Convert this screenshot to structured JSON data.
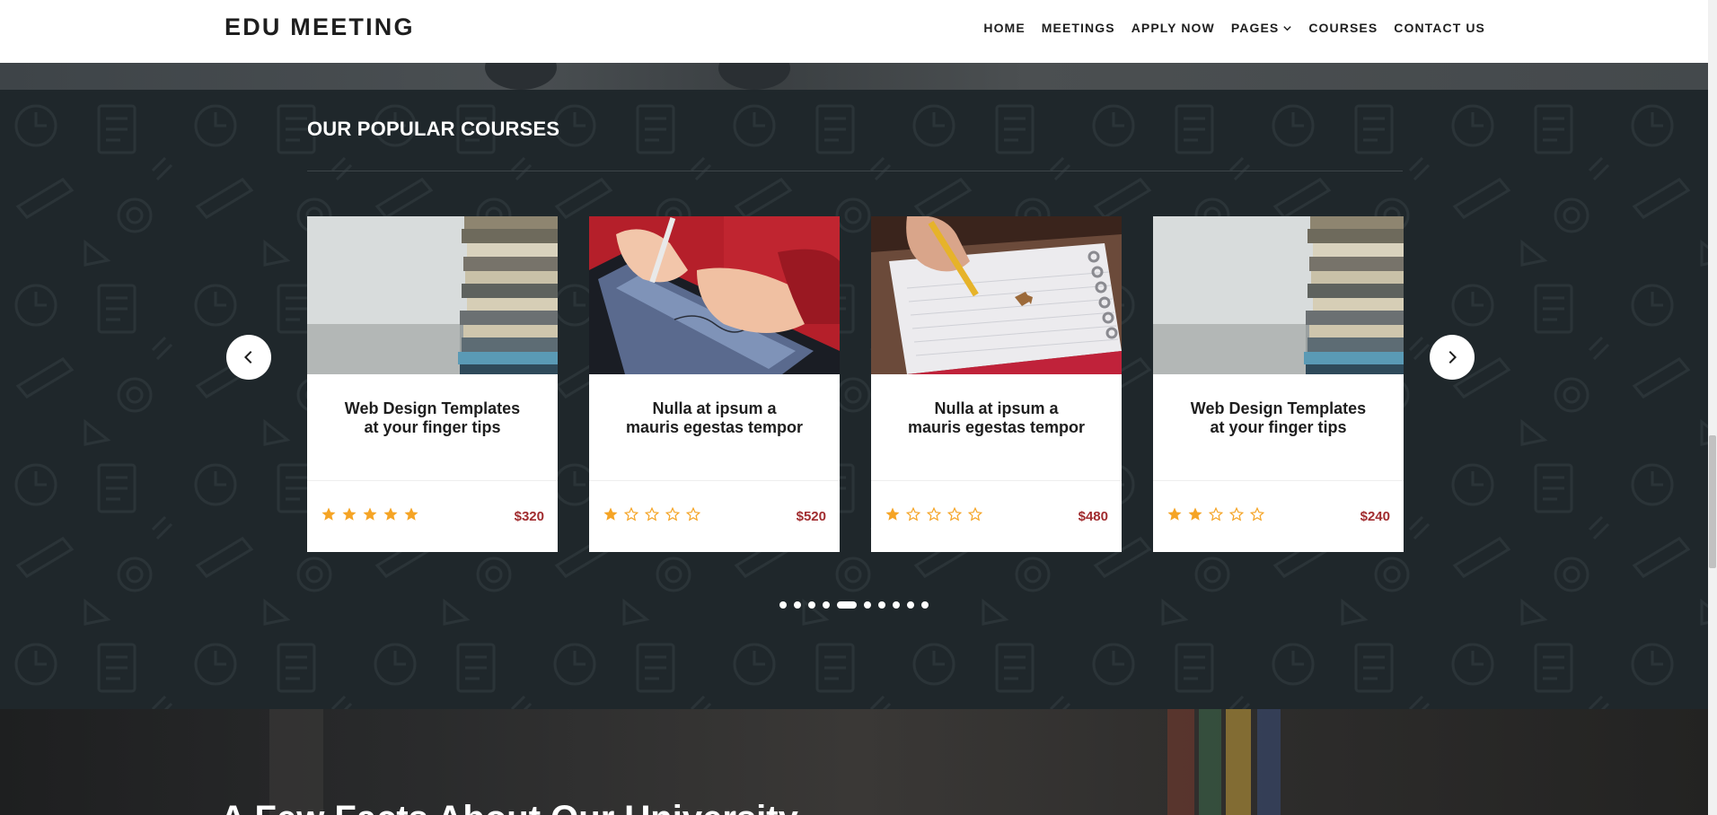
{
  "header": {
    "logo": "EDU MEETING",
    "nav": [
      {
        "label": "HOME"
      },
      {
        "label": "MEETINGS"
      },
      {
        "label": "APPLY NOW"
      },
      {
        "label": "PAGES",
        "dropdown": true
      },
      {
        "label": "COURSES"
      },
      {
        "label": "CONTACT US"
      }
    ]
  },
  "courses": {
    "title": "OUR POPULAR COURSES",
    "cards": [
      {
        "title": "Web Design Templates at your finger tips",
        "rating": 5,
        "price": "$320",
        "image": "books-stack"
      },
      {
        "title": "Nulla at ipsum a mauris egestas tempor",
        "rating": 1,
        "price": "$520",
        "image": "tablet-stylus"
      },
      {
        "title": "Nulla at ipsum a mauris egestas tempor",
        "rating": 1,
        "price": "$480",
        "image": "pencil-notebook"
      },
      {
        "title": "Web Design Templates at your finger tips",
        "rating": 2,
        "price": "$240",
        "image": "books-stack"
      }
    ],
    "carousel": {
      "dot_count": 10,
      "active_index": 4
    }
  },
  "facts": {
    "title": "A Few Facts About Our University"
  },
  "colors": {
    "accent_star": "#f5a425",
    "price": "#a12c2f",
    "section_bg": "#1f272b"
  }
}
